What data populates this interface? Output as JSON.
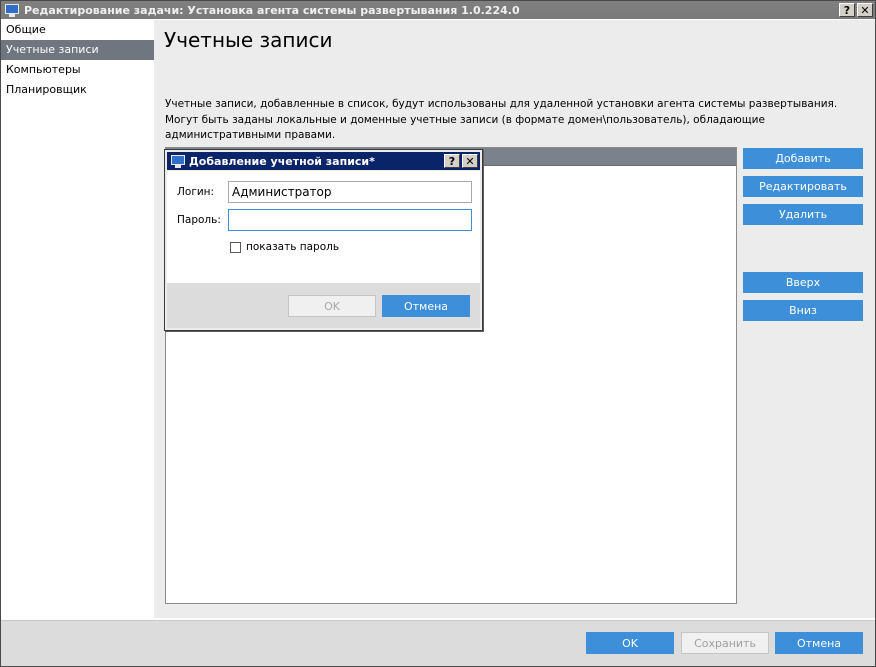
{
  "window": {
    "title": "Редактирование задачи: Установка агента системы развертывания 1.0.224.0",
    "help_label": "?",
    "close_label": "✕"
  },
  "sidebar": {
    "items": [
      {
        "label": "Общие",
        "active": false
      },
      {
        "label": "Учетные записи",
        "active": true
      },
      {
        "label": "Компьютеры",
        "active": false
      },
      {
        "label": "Планировщик",
        "active": false
      }
    ]
  },
  "main": {
    "title": "Учетные записи",
    "description": "Учетные записи, добавленные в список, будут использованы для удаленной установки агента системы развертывания. Могут быть заданы локальные и доменные учетные записи (в формате домен\\пользователь), обладающие административными правами.",
    "buttons": {
      "add": "Добавить",
      "edit": "Редактировать",
      "delete": "Удалить",
      "up": "Вверх",
      "down": "Вниз"
    }
  },
  "footer": {
    "ok": "OK",
    "save": "Сохранить",
    "cancel": "Отмена"
  },
  "dialog": {
    "title": "Добавление учетной записи*",
    "help_label": "?",
    "close_label": "✕",
    "login_label": "Логин:",
    "login_value": "Администратор",
    "password_label": "Пароль:",
    "password_value": "",
    "show_password_label": "показать пароль",
    "show_password_checked": false,
    "ok": "OK",
    "cancel": "Отмена"
  },
  "colors": {
    "accent": "#3d8fd9",
    "sidebar_active": "#6f7680",
    "dialog_title": "#0a246a"
  }
}
